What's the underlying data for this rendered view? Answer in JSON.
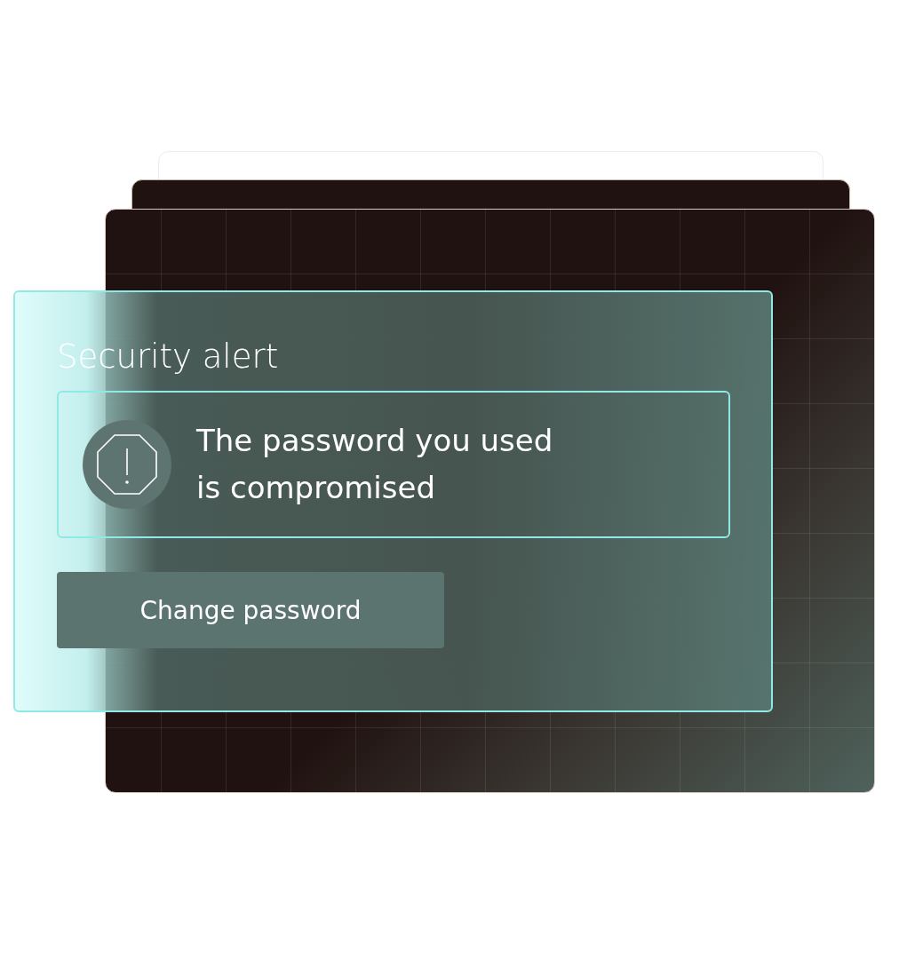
{
  "alert": {
    "title": "Security alert",
    "message": "The password you used is compromised",
    "button": "Change password"
  }
}
